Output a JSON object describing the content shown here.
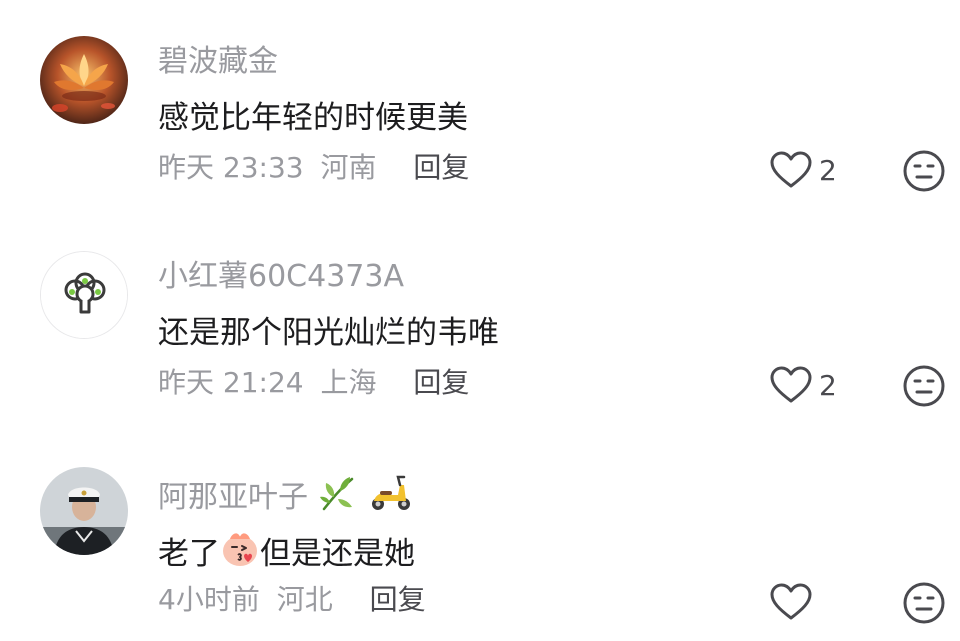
{
  "comments": [
    {
      "username": "碧波藏金",
      "text": "感觉比年轻的时候更美",
      "text_before_emoji": "",
      "text_after_emoji": "",
      "time": "昨天 23:33",
      "location": "河南",
      "reply_label": "回复",
      "like_count": "2",
      "avatar_icon": "lotus-avatar-icon",
      "badges": []
    },
    {
      "username": "小红薯60C4373A",
      "text": "还是那个阳光灿烂的韦唯",
      "text_before_emoji": "",
      "text_after_emoji": "",
      "time": "昨天 21:24",
      "location": "上海",
      "reply_label": "回复",
      "like_count": "2",
      "avatar_icon": "broccoli-avatar-icon",
      "badges": []
    },
    {
      "username": "阿那亚叶子",
      "text": "",
      "text_before_emoji": "老了",
      "text_after_emoji": "但是还是她",
      "time": "4小时前",
      "location": "河北",
      "reply_label": "回复",
      "like_count": "",
      "avatar_icon": "sailor-avatar-icon",
      "badges": [
        "leaf-icon",
        "scooter-icon"
      ]
    }
  ],
  "colors": {
    "secondary_text": "#999a9f",
    "primary_text": "#1d1d1f",
    "action_text": "#4a4a4f"
  }
}
